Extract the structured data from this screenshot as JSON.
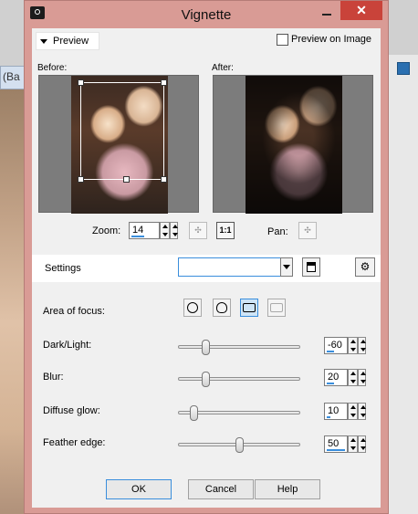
{
  "background": {
    "tab_label": "(Ba"
  },
  "dialog": {
    "title": "Vignette",
    "close_glyph": "✕"
  },
  "preview": {
    "toggle_label": "Preview",
    "preview_on_image_label": "Preview on Image",
    "before_label": "Before:",
    "after_label": "After:",
    "zoom_label": "Zoom:",
    "zoom_value": "14",
    "zoom_fit_label": "1:1",
    "pan_label": "Pan:"
  },
  "settings": {
    "label": "Settings",
    "preset_value": ""
  },
  "controls": {
    "area_of_focus_label": "Area of focus:",
    "focus_shapes": [
      "circle",
      "lasso",
      "rectangle",
      "rounded-rectangle"
    ],
    "dark_light": {
      "label": "Dark/Light:",
      "value": "-60",
      "level": 0.2
    },
    "blur": {
      "label": "Blur:",
      "value": "20",
      "level": 0.2
    },
    "diffuse_glow": {
      "label": "Diffuse glow:",
      "value": "10",
      "level": 0.1
    },
    "feather_edge": {
      "label": "Feather edge:",
      "value": "50",
      "level": 0.5
    }
  },
  "buttons": {
    "ok": "OK",
    "cancel": "Cancel",
    "help": "Help"
  },
  "colors": {
    "titlebar": "#d99b95",
    "close": "#c9433a",
    "accent": "#3a8edc"
  }
}
